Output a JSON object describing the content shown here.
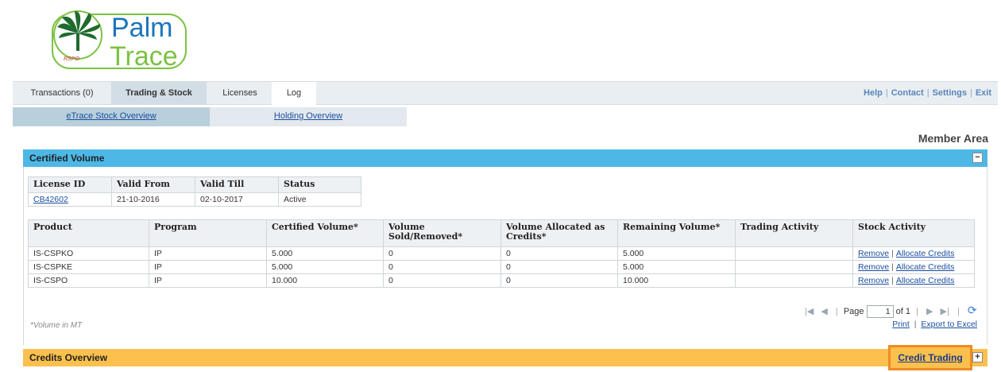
{
  "logo": {
    "text_top": "Palm",
    "text_bottom": "Trace",
    "badge": "RSPO"
  },
  "topnav": {
    "tabs": [
      {
        "label": "Transactions (0)"
      },
      {
        "label": "Trading & Stock"
      },
      {
        "label": "Licenses"
      },
      {
        "label": "Log"
      }
    ],
    "links": [
      "Help",
      "Contact",
      "Settings",
      "Exit"
    ]
  },
  "subnav": {
    "tabs": [
      {
        "label": "eTrace Stock Overview"
      },
      {
        "label": "Holding Overview"
      }
    ]
  },
  "member_area": "Member Area",
  "certified_volume": {
    "title": "Certified Volume",
    "toggle": "−",
    "license_table": {
      "headers": [
        "License ID",
        "Valid From",
        "Valid Till",
        "Status"
      ],
      "row": [
        "CB42602",
        "21-10-2016",
        "02-10-2017",
        "Active"
      ]
    },
    "volume_table": {
      "headers": [
        "Product",
        "Program",
        "Certified Volume*",
        "Volume Sold/Removed*",
        "Volume Allocated as Credits*",
        "Remaining Volume*",
        "Trading Activity",
        "Stock Activity"
      ],
      "rows": [
        [
          "IS-CSPKO",
          "IP",
          "5.000",
          "0",
          "0",
          "5.000",
          ""
        ],
        [
          "IS-CSPKE",
          "IP",
          "5.000",
          "0",
          "0",
          "5.000",
          ""
        ],
        [
          "IS-CSPO",
          "IP",
          "10.000",
          "0",
          "0",
          "10.000",
          ""
        ]
      ],
      "action_remove": "Remove",
      "action_separator": "|",
      "action_allocate": "Allocate Credits"
    },
    "pager": {
      "page_label": "Page",
      "page_value": "1",
      "of_label": "of 1"
    },
    "note": "*Volume in MT",
    "print_label": "Print",
    "export_label": "Export to Excel",
    "export_separator": "|"
  },
  "credits_overview": {
    "title": "Credits Overview",
    "credit_trading_label": "Credit Trading",
    "toggle": "+"
  },
  "colors": {
    "blue_header": "#4db8e6",
    "orange_header": "#fbc04d",
    "highlight_border": "#f08a24",
    "link": "#1c4fa0"
  }
}
